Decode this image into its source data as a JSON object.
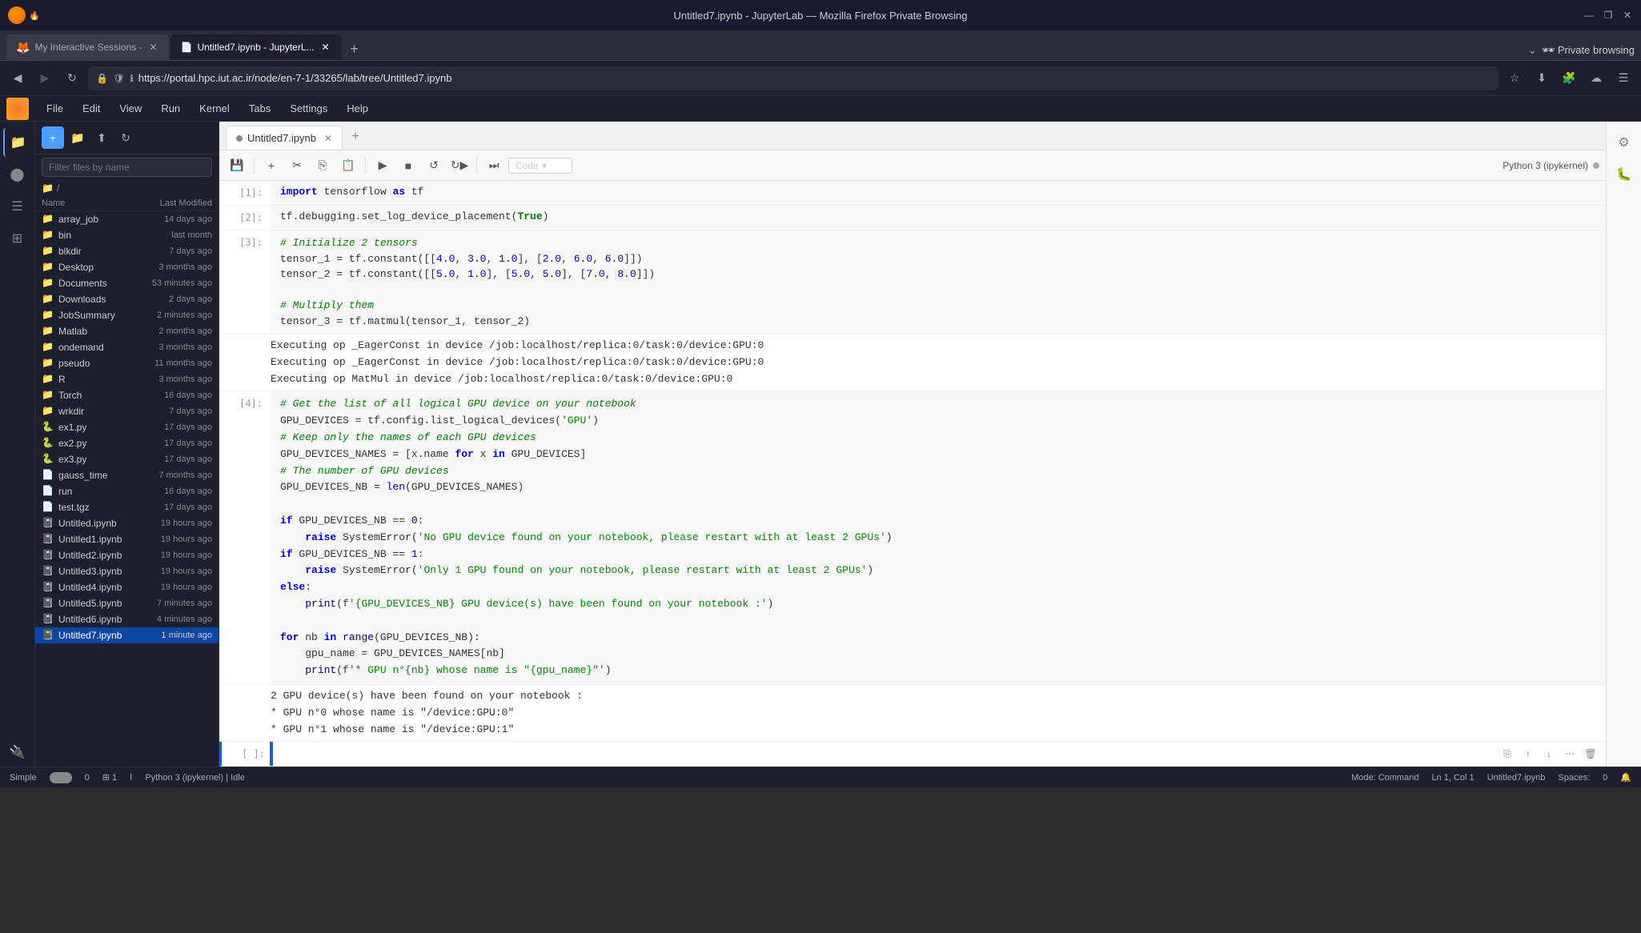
{
  "titlebar": {
    "title": "Untitled7.ipynb - JupyterLab — Mozilla Firefox Private Browsing",
    "min_btn": "—",
    "max_btn": "❐",
    "close_btn": "✕"
  },
  "tabs": [
    {
      "id": "tab1",
      "label": "My Interactive Sessions -",
      "active": false,
      "favicon_color": "#e55"
    },
    {
      "id": "tab2",
      "label": "Untitled7.ipynb - JupyterL...",
      "active": true,
      "favicon_color": "#666"
    }
  ],
  "navbar": {
    "url": "https://portal.hpc.iut.ac.ir/node/en-7-1/33265/lab/tree/Untitled7.ipynb",
    "private_label": "Private browsing"
  },
  "menubar": {
    "items": [
      "File",
      "Edit",
      "View",
      "Run",
      "Kernel",
      "Tabs",
      "Settings",
      "Help"
    ]
  },
  "file_browser": {
    "search_placeholder": "Filter files by name",
    "path": "/",
    "col_name": "Name",
    "col_modified": "Last Modified",
    "files": [
      {
        "name": "array_job",
        "type": "folder",
        "date": "14 days ago"
      },
      {
        "name": "bin",
        "type": "folder",
        "date": "last month"
      },
      {
        "name": "blkdir",
        "type": "folder",
        "date": "7 days ago"
      },
      {
        "name": "Desktop",
        "type": "folder",
        "date": "3 months ago"
      },
      {
        "name": "Documents",
        "type": "folder",
        "date": "53 minutes ago"
      },
      {
        "name": "Downloads",
        "type": "folder",
        "date": "2 days ago"
      },
      {
        "name": "JobSummary",
        "type": "folder",
        "date": "2 minutes ago"
      },
      {
        "name": "Matlab",
        "type": "folder",
        "date": "2 months ago"
      },
      {
        "name": "ondemand",
        "type": "folder",
        "date": "3 months ago"
      },
      {
        "name": "pseudo",
        "type": "folder",
        "date": "11 months ago"
      },
      {
        "name": "R",
        "type": "folder",
        "date": "3 months ago"
      },
      {
        "name": "Torch",
        "type": "folder",
        "date": "16 days ago"
      },
      {
        "name": "wrkdir",
        "type": "folder",
        "date": "7 days ago"
      },
      {
        "name": "ex1.py",
        "type": "python",
        "date": "17 days ago"
      },
      {
        "name": "ex2.py",
        "type": "python",
        "date": "17 days ago"
      },
      {
        "name": "ex3.py",
        "type": "python",
        "date": "17 days ago"
      },
      {
        "name": "gauss_time",
        "type": "file",
        "date": "7 months ago"
      },
      {
        "name": "run",
        "type": "file",
        "date": "16 days ago"
      },
      {
        "name": "test.tgz",
        "type": "file",
        "date": "17 days ago"
      },
      {
        "name": "Untitled.ipynb",
        "type": "notebook",
        "date": "19 hours ago"
      },
      {
        "name": "Untitled1.ipynb",
        "type": "notebook",
        "date": "19 hours ago"
      },
      {
        "name": "Untitled2.ipynb",
        "type": "notebook",
        "date": "19 hours ago"
      },
      {
        "name": "Untitled3.ipynb",
        "type": "notebook",
        "date": "19 hours ago"
      },
      {
        "name": "Untitled4.ipynb",
        "type": "notebook",
        "date": "19 hours ago"
      },
      {
        "name": "Untitled5.ipynb",
        "type": "notebook",
        "date": "7 minutes ago"
      },
      {
        "name": "Untitled6.ipynb",
        "type": "notebook",
        "date": "4 minutes ago"
      },
      {
        "name": "Untitled7.ipynb",
        "type": "notebook",
        "date": "1 minute ago",
        "selected": true
      }
    ]
  },
  "notebook": {
    "tab_label": "Untitled7.ipynb",
    "kernel": "Python 3 (ipykernel)",
    "cell_type": "Code",
    "toolbar_btns": [
      "save",
      "add-cell",
      "cut",
      "copy",
      "paste",
      "run",
      "stop",
      "restart",
      "restart-run",
      "skip-fwd"
    ],
    "cells": [
      {
        "number": "[1]:",
        "content_html": "<span class='kw'>import</span> tensorflow <span class='kw'>as</span> tf"
      },
      {
        "number": "[2]:",
        "content_html": "tf.debugging.set_log_device_placement(<span class='kw2'>True</span>)"
      },
      {
        "number": "[3]:",
        "content_html": "<span class='cmt'># Initialize 2 tensors</span><br>tensor_1 = tf.constant([[<span class='num'>4.0</span>, <span class='num'>3.0</span>, <span class='num'>1.0</span>], [<span class='num'>2.0</span>, <span class='num'>6.0</span>, <span class='num'>6.0</span>]])<br>tensor_2 = tf.constant([[<span class='num'>5.0</span>, <span class='num'>1.0</span>], [<span class='num'>5.0</span>, <span class='num'>5.0</span>], [<span class='num'>7.0</span>, <span class='num'>8.0</span>]])<br><br><span class='cmt'># Multiply them</span><br>tensor_3 = tf.matmul(tensor_1, tensor_2)"
      },
      {
        "number": "",
        "output": true,
        "content_html": "Executing op _EagerConst in device /job:localhost/replica:0/task:0/device:GPU:0<br>Executing op _EagerConst in device /job:localhost/replica:0/task:0/device:GPU:0<br>Executing op MatMul in device /job:localhost/replica:0/task:0/device:GPU:0"
      },
      {
        "number": "[4]:",
        "content_html": "<span class='cmt'># Get the list of all logical GPU device on your notebook</span><br>GPU_DEVICES = tf.config.list_logical_devices(<span class='str'>'GPU'</span>)<br><span class='cmt'># Keep only the names of each GPU devices</span><br>GPU_DEVICES_NAMES = [x.name <span class='kw'>for</span> x <span class='kw'>in</span> GPU_DEVICES]<br><span class='cmt'># The number of GPU devices</span><br>GPU_DEVICES_NB = <span class='fn'>len</span>(GPU_DEVICES_NAMES)<br><br><span class='kw'>if</span> GPU_DEVICES_NB == <span class='num'>0</span>:<br>&nbsp;&nbsp;&nbsp;&nbsp;<span class='kw'>raise</span> SystemError(<span class='str'>'No GPU device found on your notebook, please restart with at least 2 GPUs'</span>)<br><span class='kw'>if</span> GPU_DEVICES_NB == <span class='num'>1</span>:<br>&nbsp;&nbsp;&nbsp;&nbsp;<span class='kw'>raise</span> SystemError(<span class='str'>'Only 1 GPU found on your notebook, please restart with at least 2 GPUs'</span>)<br><span class='kw'>else</span>:<br>&nbsp;&nbsp;&nbsp;&nbsp;<span class='fn'>print</span>(f<span class='str'>'{GPU_DEVICES_NB} GPU device(s) have been found on your notebook :'</span>)<br><br><span class='kw'>for</span> nb <span class='kw'>in</span> <span class='fn'>range</span>(GPU_DEVICES_NB):<br>&nbsp;&nbsp;&nbsp;&nbsp;gpu_name = GPU_DEVICES_NAMES[nb]<br>&nbsp;&nbsp;&nbsp;&nbsp;<span class='fn'>print</span>(f<span class='str'>'* GPU n°{nb} whose name is \"{gpu_name}\"'</span>)"
      },
      {
        "number": "",
        "output": true,
        "content_html": "2 GPU device(s) have been found on your notebook :<br>* GPU n°0 whose name is \"/device:GPU:0\"<br>* GPU n°1 whose name is \"/device:GPU:1\""
      },
      {
        "number": "[ ]:",
        "content_html": "",
        "active": true
      }
    ]
  },
  "statusbar": {
    "simple_label": "Simple",
    "mode": "Mode: Command",
    "cursor": "Ln 1, Col 1",
    "kernel_name": "Untitled7.ipynb",
    "spaces": "0",
    "kernel_idle": "Python 3 (ipykernel) | Idle"
  }
}
